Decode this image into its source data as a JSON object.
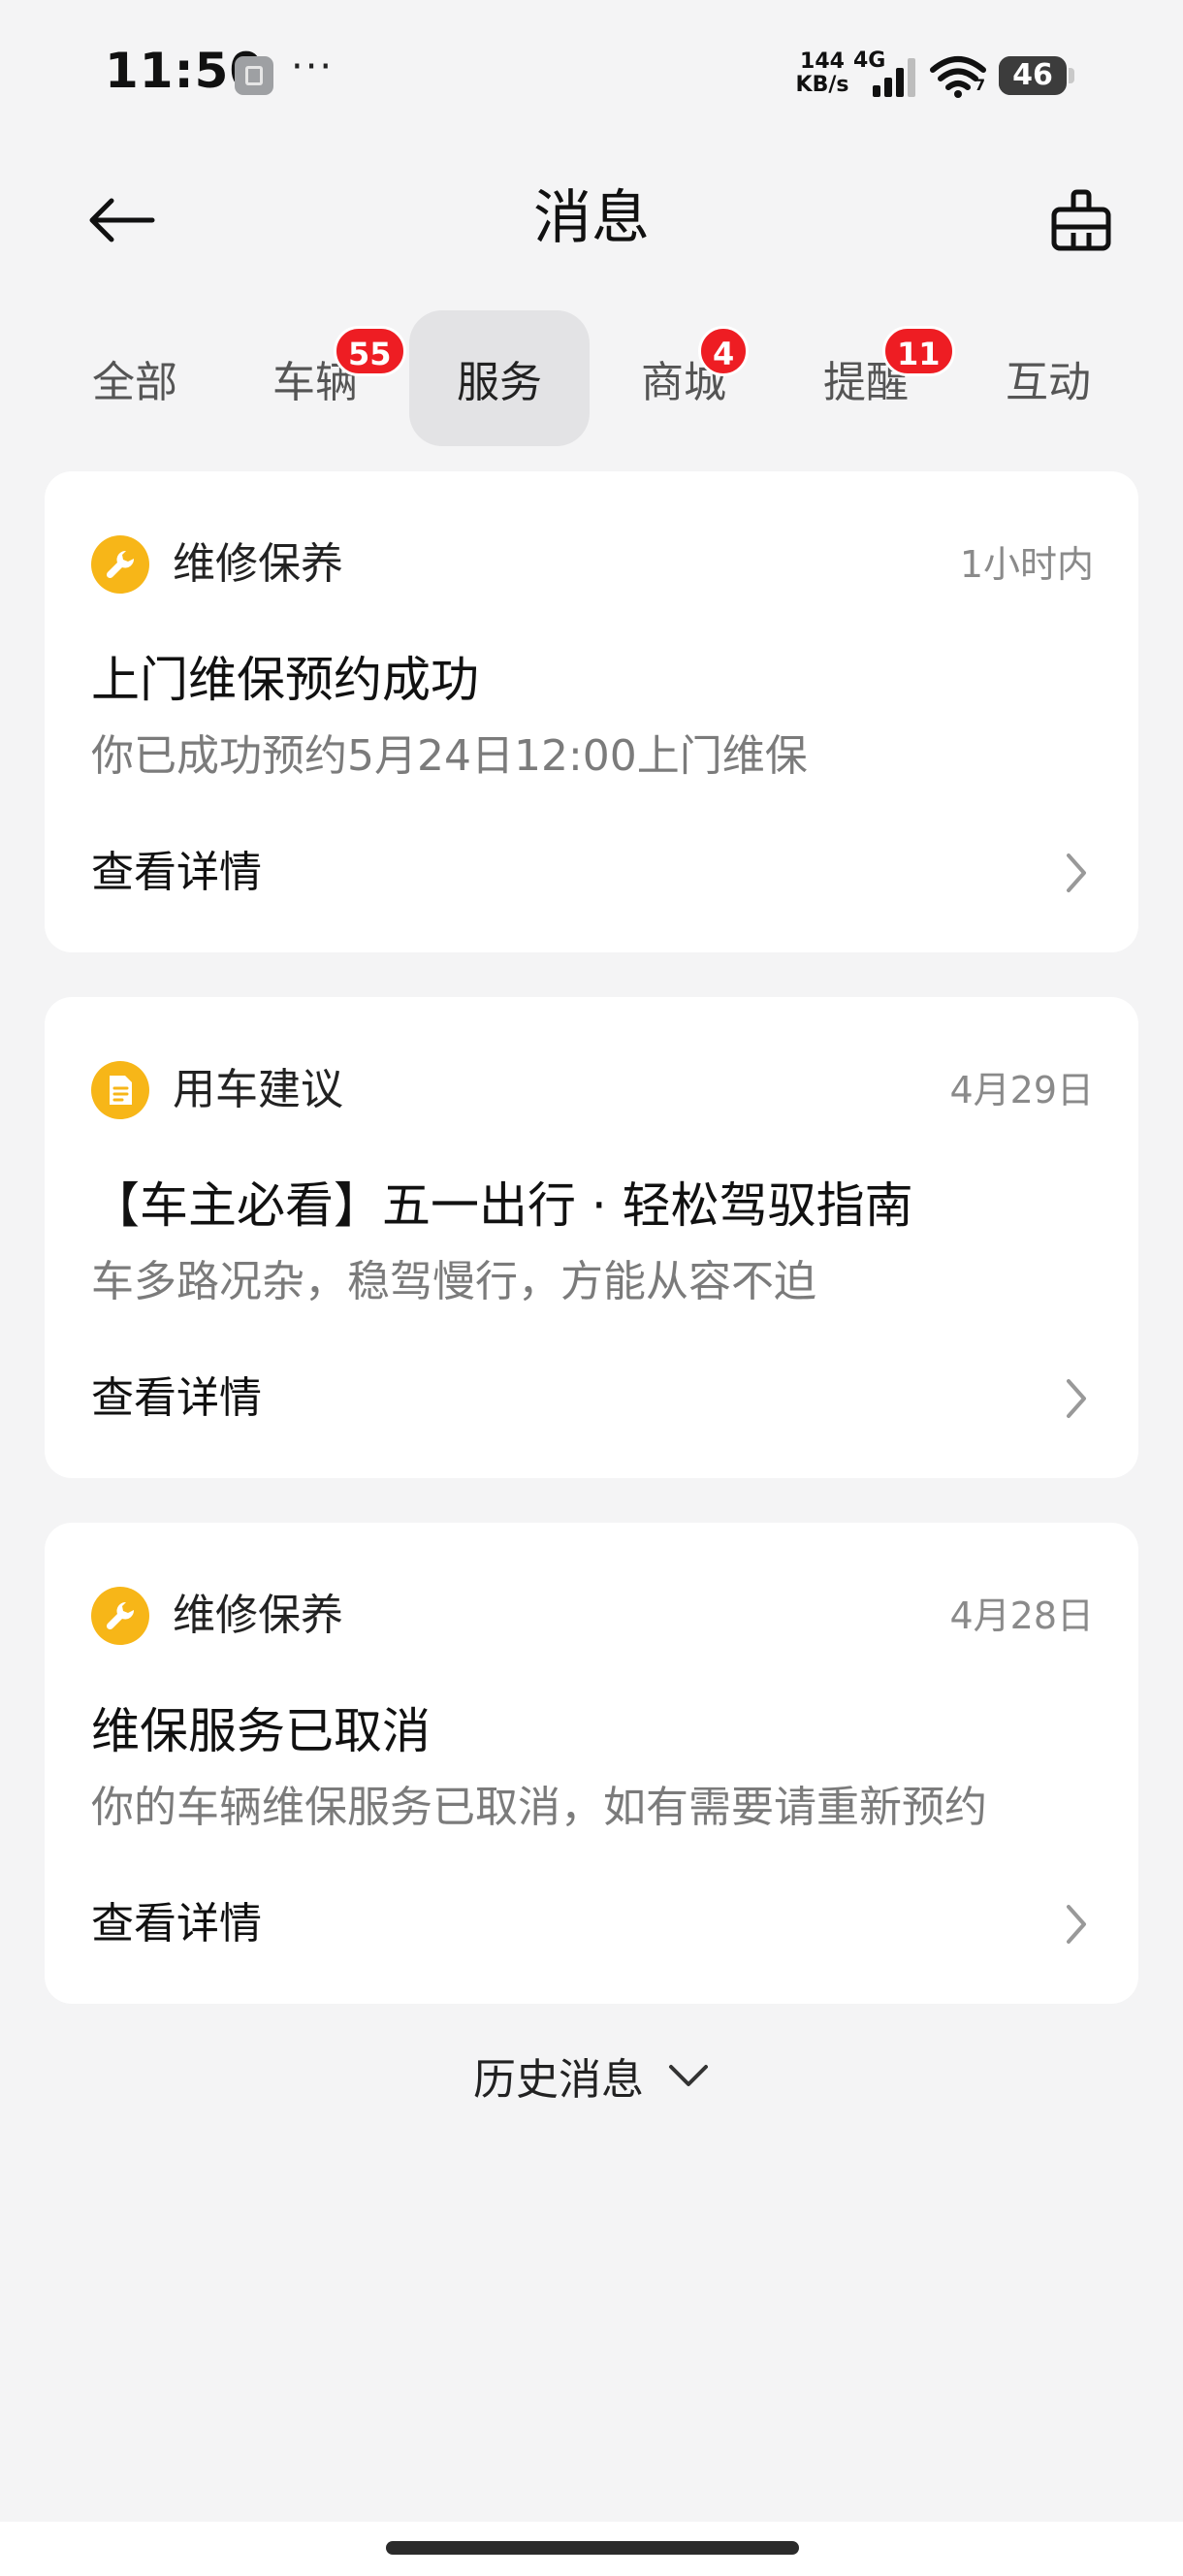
{
  "status_bar": {
    "time": "11:50",
    "dots": "···",
    "net_speed_value": "144",
    "net_speed_unit": "KB/s",
    "network_type": "4G",
    "wifi_sub": "7",
    "battery_level": "46",
    "battery_fraction": 0.46
  },
  "header": {
    "title": "消息"
  },
  "tabs": [
    {
      "label": "全部",
      "badge": ""
    },
    {
      "label": "车辆",
      "badge": "55"
    },
    {
      "label": "服务",
      "badge": "",
      "active": true
    },
    {
      "label": "商城",
      "badge": "4"
    },
    {
      "label": "提醒",
      "badge": "11"
    },
    {
      "label": "互动",
      "badge": ""
    }
  ],
  "cards": [
    {
      "icon": "wrench-icon",
      "category": "维修保养",
      "time": "1小时内",
      "title": "上门维保预约成功",
      "description": "你已成功预约5月24日12:00上门维保",
      "link_label": "查看详情"
    },
    {
      "icon": "document-icon",
      "category": "用车建议",
      "time": "4月29日",
      "title": "【车主必看】五一出行 · 轻松驾驭指南",
      "description": "车多路况杂，稳驾慢行，方能从容不迫",
      "link_label": "查看详情"
    },
    {
      "icon": "wrench-icon",
      "category": "维修保养",
      "time": "4月28日",
      "title": "维保服务已取消",
      "description": "你的车辆维保服务已取消，如有需要请重新预约",
      "link_label": "查看详情"
    }
  ],
  "history": {
    "label": "历史消息"
  },
  "colors": {
    "accent_icon": "#f7b618",
    "badge": "#ee1d23",
    "background": "#f4f4f5"
  }
}
